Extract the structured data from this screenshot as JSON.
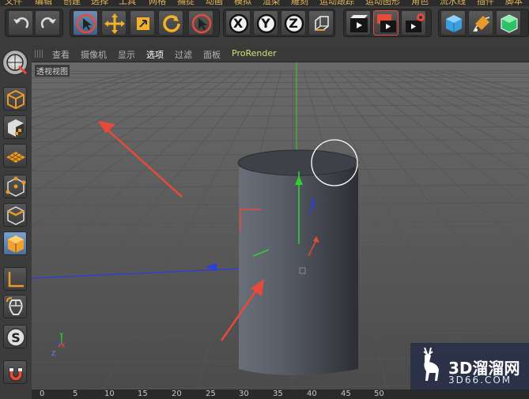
{
  "menubar": {
    "items": [
      "文件",
      "编辑",
      "创建",
      "选择",
      "工具",
      "网格",
      "捕捉",
      "动画",
      "模拟",
      "渲染",
      "雕刻",
      "运动跟踪",
      "运动图形",
      "角色",
      "流水线",
      "插件",
      "脚本"
    ]
  },
  "toolbar": {
    "buttons": [
      "undo-icon",
      "redo-icon",
      "live-selection-icon",
      "move-icon",
      "scale-icon",
      "rotate-icon",
      "recent-tool-icon",
      "lock-x-icon",
      "lock-y-icon",
      "lock-z-icon",
      "coordinate-system-icon",
      "render-view-icon",
      "render-to-picture-viewer-icon",
      "render-settings-icon",
      "cube-icon",
      "pen-icon",
      "subdivision-icon"
    ],
    "axis_labels": {
      "x": "X",
      "y": "Y",
      "z": "Z"
    }
  },
  "leftbar": {
    "buttons": [
      "make-editable-icon",
      "model-mode-icon",
      "texture-mode-icon",
      "workplane-icon",
      "points-mode-icon",
      "edges-mode-icon",
      "polygons-mode-icon",
      "enable-axis-icon",
      "tweak-mode-icon",
      "snap-icon",
      "magnet-icon"
    ]
  },
  "viewport_menu": {
    "items": [
      "查看",
      "摄像机",
      "显示",
      "选项",
      "过滤",
      "面板"
    ],
    "plugin": "ProRender"
  },
  "viewport": {
    "label": "透视视图",
    "mini_axis": {
      "y": "Y",
      "z": "Z",
      "x": "X"
    }
  },
  "ruler": {
    "ticks": [
      "0",
      "5",
      "10",
      "15",
      "20",
      "25",
      "30",
      "35",
      "40",
      "45",
      "50"
    ]
  },
  "watermark": {
    "title": "3D溜溜网",
    "url": "3D66.COM"
  },
  "colors": {
    "accent_red": "#e84a3a",
    "axis_green": "#2fd02f",
    "axis_blue": "#2b3ee0",
    "selection_blue": "#4a6f9a",
    "orange": "#e89a2a"
  }
}
